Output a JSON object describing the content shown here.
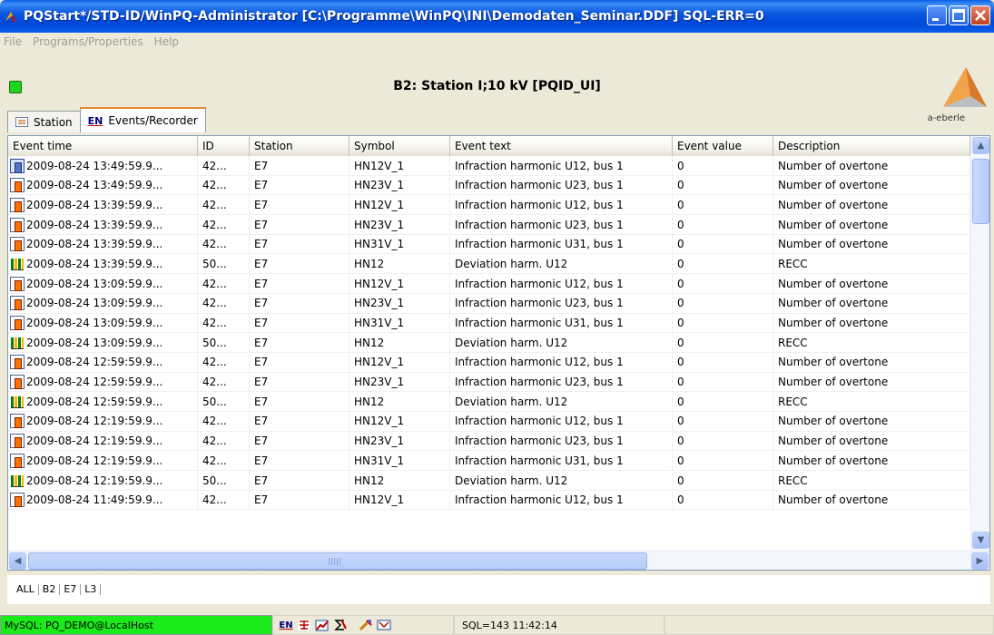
{
  "window": {
    "title": "PQStart*/STD-ID/WinPQ-Administrator [C:\\Programme\\WinPQ\\INI\\Demodaten_Seminar.DDF] SQL-ERR=0"
  },
  "menu": {
    "items": [
      "File",
      "Programs/Properties",
      "Help"
    ]
  },
  "header": {
    "title": "B2: Station I;10 kV [PQID_UI]",
    "logo_text": "a-eberle",
    "led_color": "#1dd51d"
  },
  "tabs": [
    {
      "label": "Station",
      "active": false
    },
    {
      "label": "Events/Recorder",
      "active": true,
      "icon_text": "EN"
    }
  ],
  "table": {
    "columns": [
      "Event time",
      "ID",
      "Station",
      "Symbol",
      "Event text",
      "Event value",
      "Description"
    ],
    "rows": [
      {
        "icon": "first",
        "time": "2009-08-24 13:49:59.9...",
        "id": "42...",
        "station": "E7",
        "symbol": "HN12V_1",
        "text": "Infraction harmonic U12, bus 1",
        "value": "0",
        "desc": "Number of overtone"
      },
      {
        "icon": "single",
        "time": "2009-08-24 13:49:59.9...",
        "id": "42...",
        "station": "E7",
        "symbol": "HN23V_1",
        "text": "Infraction harmonic U23, bus 1",
        "value": "0",
        "desc": "Number of overtone"
      },
      {
        "icon": "single",
        "time": "2009-08-24 13:39:59.9...",
        "id": "42...",
        "station": "E7",
        "symbol": "HN12V_1",
        "text": "Infraction harmonic U12, bus 1",
        "value": "0",
        "desc": "Number of overtone"
      },
      {
        "icon": "single",
        "time": "2009-08-24 13:39:59.9...",
        "id": "42...",
        "station": "E7",
        "symbol": "HN23V_1",
        "text": "Infraction harmonic U23, bus 1",
        "value": "0",
        "desc": "Number of overtone"
      },
      {
        "icon": "single",
        "time": "2009-08-24 13:39:59.9...",
        "id": "42...",
        "station": "E7",
        "symbol": "HN31V_1",
        "text": "Infraction harmonic U31, bus 1",
        "value": "0",
        "desc": "Number of overtone"
      },
      {
        "icon": "multi",
        "time": "2009-08-24 13:39:59.9...",
        "id": "50...",
        "station": "E7",
        "symbol": "HN12",
        "text": "Deviation harm. U12",
        "value": "0",
        "desc": "RECC"
      },
      {
        "icon": "single",
        "time": "2009-08-24 13:09:59.9...",
        "id": "42...",
        "station": "E7",
        "symbol": "HN12V_1",
        "text": "Infraction harmonic U12, bus 1",
        "value": "0",
        "desc": "Number of overtone"
      },
      {
        "icon": "single",
        "time": "2009-08-24 13:09:59.9...",
        "id": "42...",
        "station": "E7",
        "symbol": "HN23V_1",
        "text": "Infraction harmonic U23, bus 1",
        "value": "0",
        "desc": "Number of overtone"
      },
      {
        "icon": "single",
        "time": "2009-08-24 13:09:59.9...",
        "id": "42...",
        "station": "E7",
        "symbol": "HN31V_1",
        "text": "Infraction harmonic U31, bus 1",
        "value": "0",
        "desc": "Number of overtone"
      },
      {
        "icon": "multi",
        "time": "2009-08-24 13:09:59.9...",
        "id": "50...",
        "station": "E7",
        "symbol": "HN12",
        "text": "Deviation harm. U12",
        "value": "0",
        "desc": "RECC"
      },
      {
        "icon": "single",
        "time": "2009-08-24 12:59:59.9...",
        "id": "42...",
        "station": "E7",
        "symbol": "HN12V_1",
        "text": "Infraction harmonic U12, bus 1",
        "value": "0",
        "desc": "Number of overtone"
      },
      {
        "icon": "single",
        "time": "2009-08-24 12:59:59.9...",
        "id": "42...",
        "station": "E7",
        "symbol": "HN23V_1",
        "text": "Infraction harmonic U23, bus 1",
        "value": "0",
        "desc": "Number of overtone"
      },
      {
        "icon": "multi",
        "time": "2009-08-24 12:59:59.9...",
        "id": "50...",
        "station": "E7",
        "symbol": "HN12",
        "text": "Deviation harm. U12",
        "value": "0",
        "desc": "RECC"
      },
      {
        "icon": "single",
        "time": "2009-08-24 12:19:59.9...",
        "id": "42...",
        "station": "E7",
        "symbol": "HN12V_1",
        "text": "Infraction harmonic U12, bus 1",
        "value": "0",
        "desc": "Number of overtone"
      },
      {
        "icon": "single",
        "time": "2009-08-24 12:19:59.9...",
        "id": "42...",
        "station": "E7",
        "symbol": "HN23V_1",
        "text": "Infraction harmonic U23, bus 1",
        "value": "0",
        "desc": "Number of overtone"
      },
      {
        "icon": "single",
        "time": "2009-08-24 12:19:59.9...",
        "id": "42...",
        "station": "E7",
        "symbol": "HN31V_1",
        "text": "Infraction harmonic U31, bus 1",
        "value": "0",
        "desc": "Number of overtone"
      },
      {
        "icon": "multi",
        "time": "2009-08-24 12:19:59.9...",
        "id": "50...",
        "station": "E7",
        "symbol": "HN12",
        "text": "Deviation harm. U12",
        "value": "0",
        "desc": "RECC"
      },
      {
        "icon": "single",
        "time": "2009-08-24 11:49:59.9...",
        "id": "42...",
        "station": "E7",
        "symbol": "HN12V_1",
        "text": "Infraction harmonic U12, bus 1",
        "value": "0",
        "desc": "Number of overtone"
      }
    ]
  },
  "filter": {
    "items": [
      "ALL",
      "B2",
      "E7",
      "L3"
    ]
  },
  "status": {
    "db": "MySQL: PQ_DEMO@LocalHost",
    "lang": "EN",
    "sql": "SQL=143 11:42:14",
    "db_color": "#1bea1b"
  }
}
